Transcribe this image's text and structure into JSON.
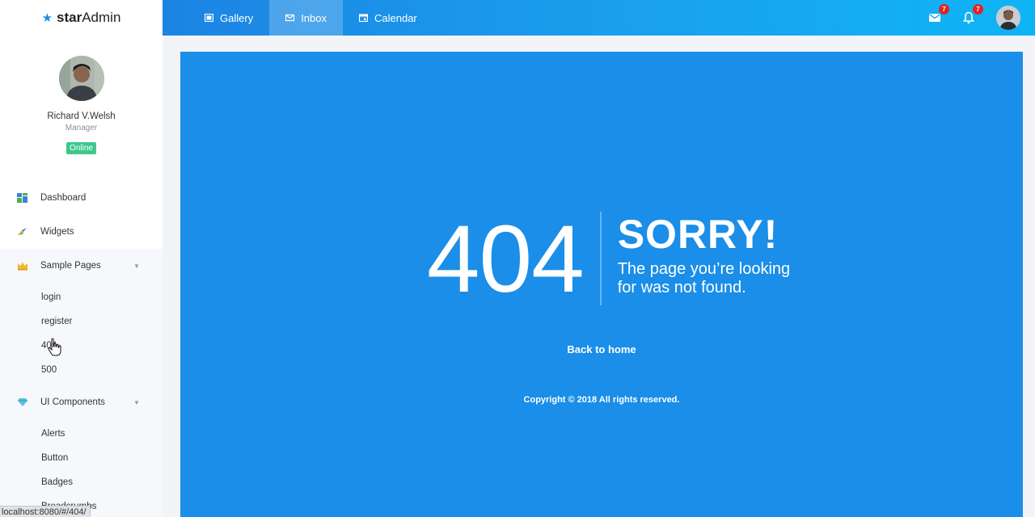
{
  "brand": {
    "prefix": "star",
    "suffix": "Admin"
  },
  "topnav": {
    "links": [
      {
        "label": "Gallery",
        "icon": "gallery-icon"
      },
      {
        "label": "Inbox",
        "icon": "mail-icon",
        "active": true
      },
      {
        "label": "Calendar",
        "icon": "calendar-icon"
      }
    ],
    "mail_badge": "7",
    "notif_badge": "7"
  },
  "profile": {
    "name": "Richard V.Welsh",
    "role": "Manager",
    "status": "Online"
  },
  "sidebar": {
    "items": [
      {
        "label": "Dashboard",
        "icon": "dashboard-icon"
      },
      {
        "label": "Widgets",
        "icon": "widgets-icon"
      },
      {
        "label": "Sample Pages",
        "icon": "crown-icon",
        "expanded": true,
        "children": [
          "login",
          "register",
          "404",
          "500"
        ]
      },
      {
        "label": "UI Components",
        "icon": "diamond-icon",
        "expanded": true,
        "children": [
          "Alerts",
          "Button",
          "Badges",
          "Breadcrumbs"
        ]
      }
    ]
  },
  "error": {
    "code": "404",
    "title": "SORRY!",
    "message_line1": "The page you’re looking",
    "message_line2": "for was not found.",
    "home_link": "Back to home",
    "copyright": "Copyright © 2018 All rights reserved."
  },
  "status_url": "localhost:8080/#/404/",
  "colors": {
    "accent": "#1a8ee8",
    "online": "#3ec88a",
    "badge": "#e02424"
  }
}
